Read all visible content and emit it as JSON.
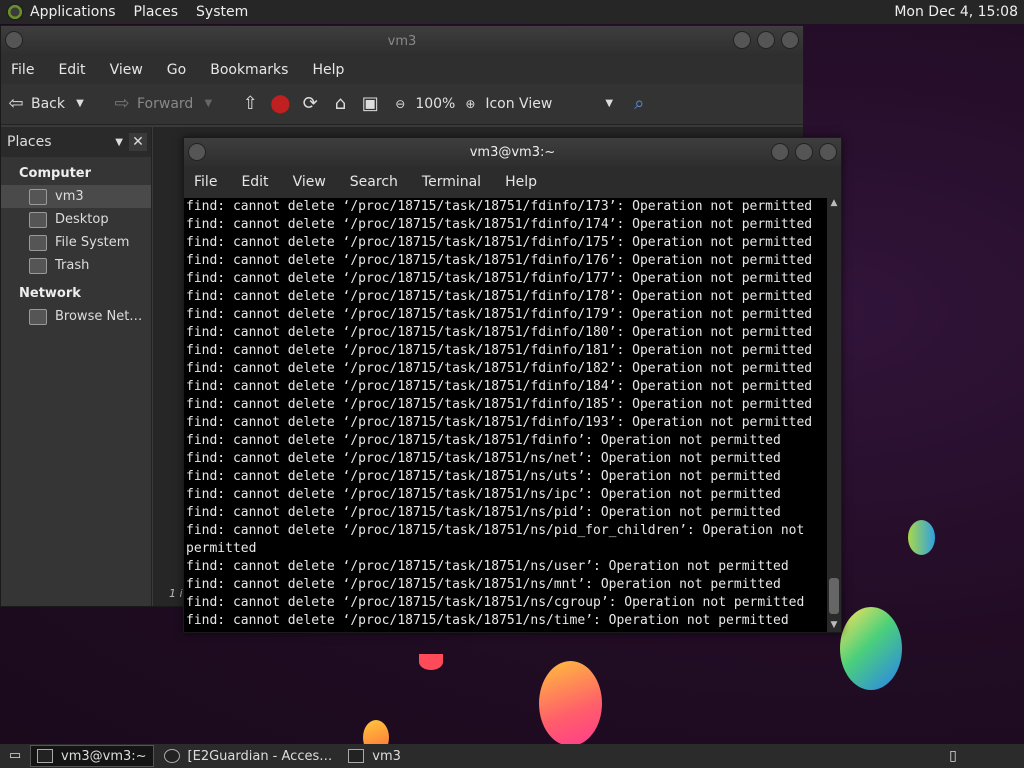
{
  "top_panel": {
    "menus": [
      "Applications",
      "Places",
      "System"
    ],
    "clock": "Mon Dec  4, 15:08"
  },
  "file_manager": {
    "title": "vm3",
    "menu": [
      "File",
      "Edit",
      "View",
      "Go",
      "Bookmarks",
      "Help"
    ],
    "toolbar": {
      "back": "Back",
      "forward": "Forward",
      "zoom": "100%",
      "view_mode": "Icon View"
    },
    "sidebar": {
      "header": "Places",
      "computer_label": "Computer",
      "computer_items": [
        "vm3",
        "Desktop",
        "File System",
        "Trash"
      ],
      "network_label": "Network",
      "network_items": [
        "Browse Net…"
      ]
    },
    "status_fragment": "1 i"
  },
  "terminal": {
    "title": "vm3@vm3:~",
    "menu": [
      "File",
      "Edit",
      "View",
      "Search",
      "Terminal",
      "Help"
    ],
    "lines": [
      "find: cannot delete ‘/proc/18715/task/18751/fdinfo/173’: Operation not permitted",
      "find: cannot delete ‘/proc/18715/task/18751/fdinfo/174’: Operation not permitted",
      "find: cannot delete ‘/proc/18715/task/18751/fdinfo/175’: Operation not permitted",
      "find: cannot delete ‘/proc/18715/task/18751/fdinfo/176’: Operation not permitted",
      "find: cannot delete ‘/proc/18715/task/18751/fdinfo/177’: Operation not permitted",
      "find: cannot delete ‘/proc/18715/task/18751/fdinfo/178’: Operation not permitted",
      "find: cannot delete ‘/proc/18715/task/18751/fdinfo/179’: Operation not permitted",
      "find: cannot delete ‘/proc/18715/task/18751/fdinfo/180’: Operation not permitted",
      "find: cannot delete ‘/proc/18715/task/18751/fdinfo/181’: Operation not permitted",
      "find: cannot delete ‘/proc/18715/task/18751/fdinfo/182’: Operation not permitted",
      "find: cannot delete ‘/proc/18715/task/18751/fdinfo/184’: Operation not permitted",
      "find: cannot delete ‘/proc/18715/task/18751/fdinfo/185’: Operation not permitted",
      "find: cannot delete ‘/proc/18715/task/18751/fdinfo/193’: Operation not permitted",
      "find: cannot delete ‘/proc/18715/task/18751/fdinfo’: Operation not permitted",
      "find: cannot delete ‘/proc/18715/task/18751/ns/net’: Operation not permitted",
      "find: cannot delete ‘/proc/18715/task/18751/ns/uts’: Operation not permitted",
      "find: cannot delete ‘/proc/18715/task/18751/ns/ipc’: Operation not permitted",
      "find: cannot delete ‘/proc/18715/task/18751/ns/pid’: Operation not permitted",
      "find: cannot delete ‘/proc/18715/task/18751/ns/pid_for_children’: Operation not",
      "permitted",
      "find: cannot delete ‘/proc/18715/task/18751/ns/user’: Operation not permitted",
      "find: cannot delete ‘/proc/18715/task/18751/ns/mnt’: Operation not permitted",
      "find: cannot delete ‘/proc/18715/task/18751/ns/cgroup’: Operation not permitted",
      "find: cannot delete ‘/proc/18715/task/18751/ns/time’: Operation not permitted"
    ]
  },
  "taskbar": {
    "tasks": [
      "vm3@vm3:~",
      "[E2Guardian - Acces…",
      "vm3"
    ]
  }
}
